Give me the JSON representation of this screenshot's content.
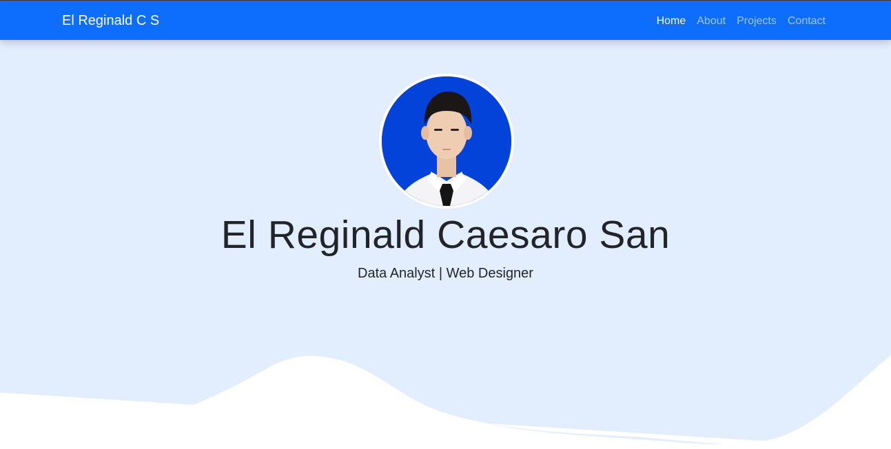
{
  "navbar": {
    "brand": "El Reginald C S",
    "links": [
      {
        "label": "Home",
        "active": true
      },
      {
        "label": "About",
        "active": false
      },
      {
        "label": "Projects",
        "active": false
      },
      {
        "label": "Contact",
        "active": false
      }
    ]
  },
  "hero": {
    "name": "El Reginald Caesaro San",
    "subtitle": "Data Analyst | Web Designer",
    "avatar_icon": "profile-photo"
  },
  "colors": {
    "navbar": "#0d6efd",
    "hero_background": "#e2edfe",
    "avatar_background": "#0443d9",
    "text": "#212529"
  }
}
